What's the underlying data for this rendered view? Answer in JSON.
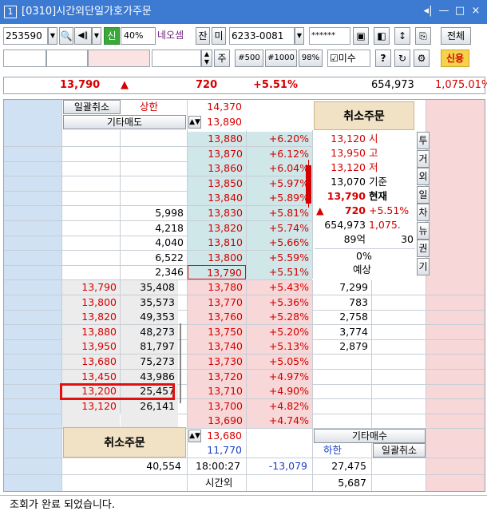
{
  "titlebar": {
    "window_number": "1",
    "title": "[0310]시간외단일가호가주문",
    "controls": [
      "◂|",
      "—",
      "□",
      "×"
    ]
  },
  "toolbar": {
    "code": "253590",
    "sin": "신",
    "percent": "40%",
    "name": "네오셈",
    "jan": "잔",
    "mi": "미",
    "account": "6233-0081",
    "password": "******",
    "all_label": "전체"
  },
  "toolbar2": {
    "ju": "주",
    "q500": "#500",
    "q1000": "#1000",
    "pct98": "98%",
    "misu": "미수",
    "help": "?",
    "credit": "신용"
  },
  "quote": {
    "price": "13,790",
    "arrow": "▲",
    "change": "720",
    "rate": "+5.51%",
    "volume": "654,973",
    "turnover": "1,075.01%"
  },
  "top_left": {
    "bulk_cancel": "일괄취소",
    "upper_limit": "상한",
    "other_sell": "기타매도"
  },
  "top_prices": {
    "upper_price": "14,370",
    "extra_price": "13,890"
  },
  "cancel_order": "취소주문",
  "sell_rows": [
    {
      "qty": "",
      "price": "13,880",
      "rate": "+6.20%"
    },
    {
      "qty": "",
      "price": "13,870",
      "rate": "+6.12%"
    },
    {
      "qty": "",
      "price": "13,860",
      "rate": "+6.04%"
    },
    {
      "qty": "",
      "price": "13,850",
      "rate": "+5.97%"
    },
    {
      "qty": "",
      "price": "13,840",
      "rate": "+5.89%"
    },
    {
      "qty": "5,998",
      "price": "13,830",
      "rate": "+5.81%"
    },
    {
      "qty": "4,218",
      "price": "13,820",
      "rate": "+5.74%"
    },
    {
      "qty": "4,040",
      "price": "13,810",
      "rate": "+5.66%"
    },
    {
      "qty": "6,522",
      "price": "13,800",
      "rate": "+5.59%"
    },
    {
      "qty": "2,346",
      "price": "13,790",
      "rate": "+5.51%"
    }
  ],
  "info_panel": {
    "high_price": "13,120",
    "high_label": "시",
    "h2_price": "13,950",
    "h2_label": "고",
    "low_price": "13,120",
    "low_label": "저",
    "base_price": "13,070",
    "base_label": "기준",
    "cur_price": "13,790",
    "cur_label": "현재",
    "arrow": "▲",
    "change": "720",
    "rate": "+5.51%",
    "vol": "654,973",
    "vol_rate": "1,075.",
    "amount": "89억",
    "amount2": "30",
    "zero_pct": "0%",
    "expected": "예상"
  },
  "side_buttons": [
    "투",
    "거",
    "외",
    "일",
    "차",
    "뉴",
    "권",
    "기"
  ],
  "buy_rows": [
    {
      "left_price": "13,790",
      "left_qty": "35,408",
      "price": "13,780",
      "rate": "+5.43%",
      "qty": "7,299"
    },
    {
      "left_price": "13,800",
      "left_qty": "35,573",
      "price": "13,770",
      "rate": "+5.36%",
      "qty": "783"
    },
    {
      "left_price": "13,820",
      "left_qty": "49,353",
      "price": "13,760",
      "rate": "+5.28%",
      "qty": "2,758"
    },
    {
      "left_price": "13,880",
      "left_qty": "48,273",
      "price": "13,750",
      "rate": "+5.20%",
      "qty": "3,774"
    },
    {
      "left_price": "13,950",
      "left_qty": "81,797",
      "price": "13,740",
      "rate": "+5.13%",
      "qty": "2,879"
    },
    {
      "left_price": "13,680",
      "left_qty": "75,273",
      "price": "13,730",
      "rate": "+5.05%",
      "qty": ""
    },
    {
      "left_price": "13,450",
      "left_qty": "43,986",
      "price": "13,720",
      "rate": "+4.97%",
      "qty": ""
    },
    {
      "left_price": "13,200",
      "left_qty": "25,457",
      "price": "13,710",
      "rate": "+4.90%",
      "qty": ""
    },
    {
      "left_price": "13,120",
      "left_qty": "26,141",
      "price": "13,700",
      "rate": "+4.82%",
      "qty": ""
    },
    {
      "left_price": "",
      "left_qty": "",
      "price": "13,690",
      "rate": "+4.74%",
      "qty": ""
    }
  ],
  "bottom": {
    "cancel_order": "취소주문",
    "lower_extra": "13,680",
    "lower_limit_price": "11,770",
    "other_buy": "기타매수",
    "lower_limit": "하한",
    "bulk_cancel": "일괄취소",
    "sell_total": "40,554",
    "time": "18:00:27",
    "diff": "-13,079",
    "buy_total": "27,475",
    "afterhours": "시간외",
    "afterhours_qty": "5,687"
  },
  "status": "조회가 완료 되었습니다."
}
